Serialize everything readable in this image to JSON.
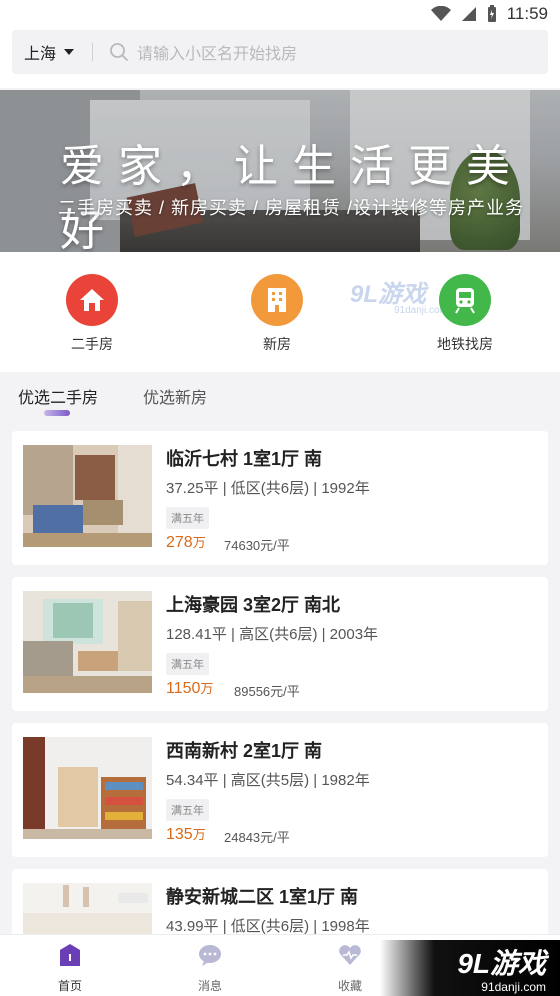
{
  "status_bar": {
    "time": "11:59"
  },
  "search": {
    "city": "上海",
    "placeholder": "请输入小区名开始找房"
  },
  "banner": {
    "title": "爱家，让生活更美好",
    "subtitle": "二手房买卖 / 新房买卖 / 房屋租赁 /设计装修等房产业务"
  },
  "categories": [
    {
      "label": "二手房",
      "icon": "house-icon",
      "color": "#e9433a"
    },
    {
      "label": "新房",
      "icon": "building-icon",
      "color": "#f29a3b"
    },
    {
      "label": "地铁找房",
      "icon": "train-icon",
      "color": "#43b84a"
    }
  ],
  "watermark": {
    "brand": "9L游戏",
    "domain": "91danji.com"
  },
  "tabs": [
    {
      "label": "优选二手房",
      "active": true
    },
    {
      "label": "优选新房",
      "active": false
    }
  ],
  "listings": [
    {
      "title": "临沂七村 1室1厅 南",
      "info": "37.25平 | 低区(共6层) | 1992年",
      "tag": "满五年",
      "price": "278",
      "price_unit": "万",
      "unit_price": "74630元/平"
    },
    {
      "title": "上海豪园 3室2厅 南北",
      "info": "128.41平 | 高区(共6层) | 2003年",
      "tag": "满五年",
      "price": "1150",
      "price_unit": "万",
      "unit_price": "89556元/平"
    },
    {
      "title": "西南新村 2室1厅 南",
      "info": "54.34平 | 高区(共5层) | 1982年",
      "tag": "满五年",
      "price": "135",
      "price_unit": "万",
      "unit_price": "24843元/平"
    },
    {
      "title": "静安新城二区 1室1厅 南",
      "info": "43.99平 | 低区(共6层) | 1998年",
      "tag": "",
      "price": "",
      "price_unit": "",
      "unit_price": ""
    }
  ],
  "bottom_nav": [
    {
      "label": "首页",
      "icon": "home-icon",
      "active": true
    },
    {
      "label": "消息",
      "icon": "message-icon",
      "active": false
    },
    {
      "label": "收藏",
      "icon": "heart-icon",
      "active": false
    }
  ],
  "colors": {
    "accent": "#6a3fb5",
    "price": "#d96a19"
  }
}
